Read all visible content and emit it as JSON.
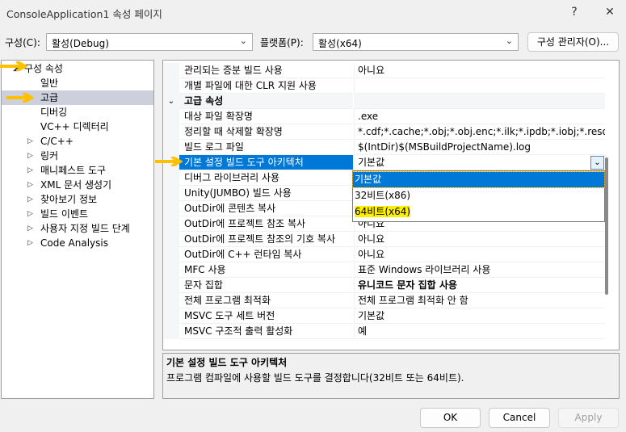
{
  "window": {
    "title": "ConsoleApplication1 속성 페이지",
    "help": "?",
    "close": "✕"
  },
  "config": {
    "config_label": "구성(C):",
    "config_value": "활성(Debug)",
    "platform_label": "플랫폼(P):",
    "platform_value": "활성(x64)",
    "manager_button": "구성 관리자(O)..."
  },
  "tree": [
    {
      "label": "구성 속성",
      "level": 0,
      "expander": "expanded"
    },
    {
      "label": "일반",
      "level": 1
    },
    {
      "label": "고급",
      "level": 1,
      "selected": true
    },
    {
      "label": "디버깅",
      "level": 1
    },
    {
      "label": "VC++ 디렉터리",
      "level": 1
    },
    {
      "label": "C/C++",
      "level": 1,
      "expander": "collapsed"
    },
    {
      "label": "링커",
      "level": 1,
      "expander": "collapsed"
    },
    {
      "label": "매니페스트 도구",
      "level": 1,
      "expander": "collapsed"
    },
    {
      "label": "XML 문서 생성기",
      "level": 1,
      "expander": "collapsed"
    },
    {
      "label": "찾아보기 정보",
      "level": 1,
      "expander": "collapsed"
    },
    {
      "label": "빌드 이벤트",
      "level": 1,
      "expander": "collapsed"
    },
    {
      "label": "사용자 지정 빌드 단계",
      "level": 1,
      "expander": "collapsed"
    },
    {
      "label": "Code Analysis",
      "level": 1,
      "expander": "collapsed"
    }
  ],
  "properties": [
    {
      "name": "관리되는 증분 빌드 사용",
      "value": "아니요"
    },
    {
      "name": "개별 파일에 대한 CLR 지원 사용",
      "value": ""
    },
    {
      "name": "고급 속성",
      "category": true
    },
    {
      "name": "대상 파일 확장명",
      "value": ".exe"
    },
    {
      "name": "정리할 때 삭제할 확장명",
      "value": "*.cdf;*.cache;*.obj;*.obj.enc;*.ilk;*.ipdb;*.iobj;*.resources;*.tlb"
    },
    {
      "name": "빌드 로그 파일",
      "value": "$(IntDir)$(MSBuildProjectName).log"
    },
    {
      "name": "기본 설정 빌드 도구 아키텍처",
      "value": "기본값",
      "selected": true
    },
    {
      "name": "디버그 라이브러리 사용",
      "value": ""
    },
    {
      "name": "Unity(JUMBO) 빌드 사용",
      "value": ""
    },
    {
      "name": "OutDir에 콘텐츠 복사",
      "value": ""
    },
    {
      "name": "OutDir에 프로젝트 참조 복사",
      "value": "아니요"
    },
    {
      "name": "OutDir에 프로젝트 참조의 기호 복사",
      "value": "아니요"
    },
    {
      "name": "OutDir에 C++ 런타임 복사",
      "value": "아니요"
    },
    {
      "name": "MFC 사용",
      "value": "표준 Windows 라이브러리 사용"
    },
    {
      "name": "문자 집합",
      "value": "유니코드 문자 집합 사용",
      "bold": true
    },
    {
      "name": "전체 프로그램 최적화",
      "value": "전체 프로그램 최적화 안 함"
    },
    {
      "name": "MSVC 도구 세트 버전",
      "value": "기본값"
    },
    {
      "name": "MSVC 구조적 출력 활성화",
      "value": "예"
    }
  ],
  "dropdown": {
    "options": [
      "기본값",
      "32비트(x86)",
      "64비트(x64)"
    ],
    "selected": 0,
    "highlighted": 2
  },
  "description": {
    "title": "기본 설정 빌드 도구 아키텍처",
    "text": "프로그램 컴파일에 사용할 빌드 도구를 결정합니다(32비트 또는 64비트)."
  },
  "buttons": {
    "ok": "OK",
    "cancel": "Cancel",
    "apply": "Apply"
  },
  "colors": {
    "selection": "#0078d7",
    "annotation": "#ffc000",
    "highlight": "#ffef00"
  }
}
